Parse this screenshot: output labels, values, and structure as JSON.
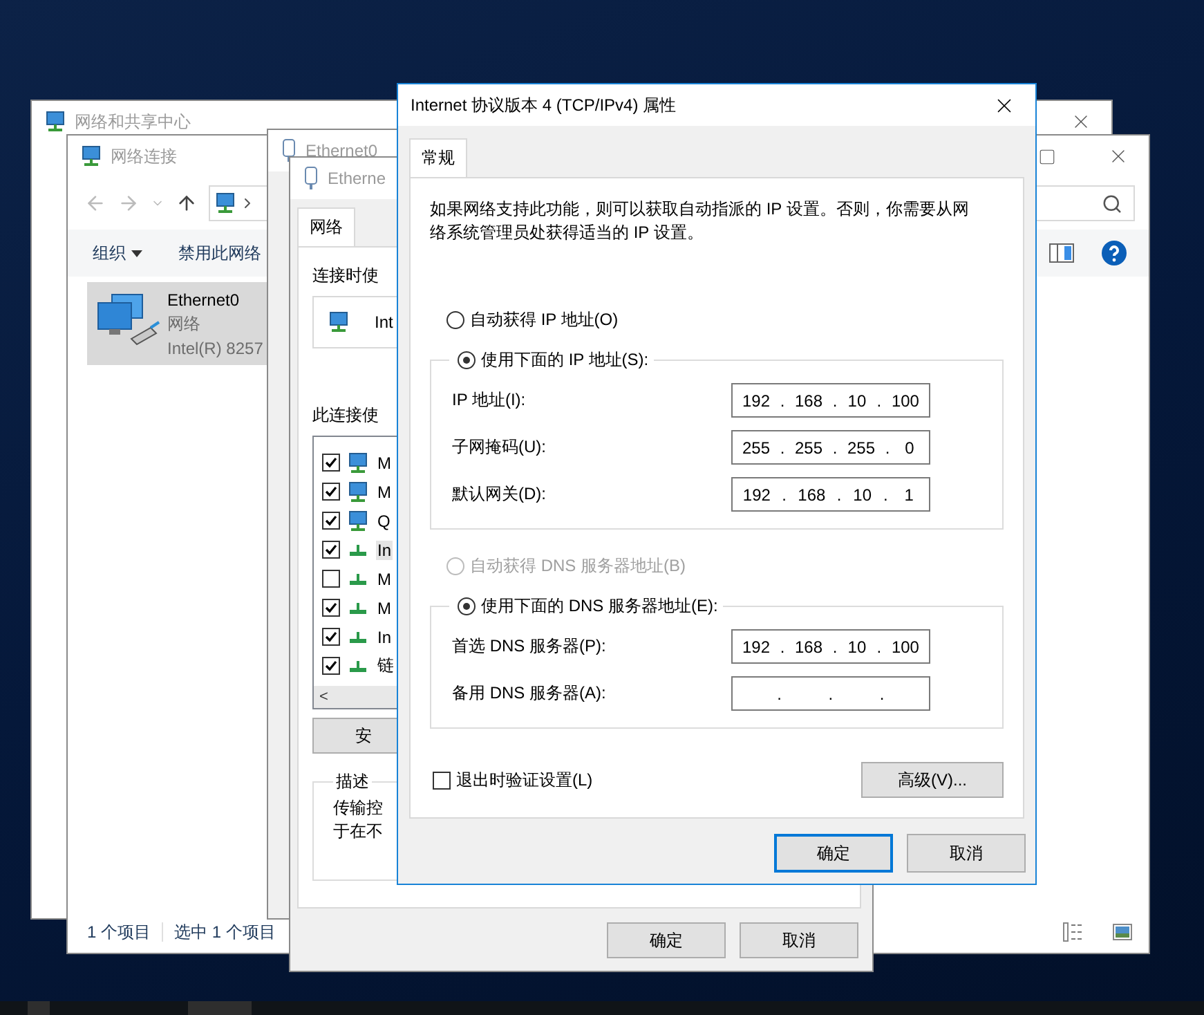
{
  "network_center": {
    "title": "网络和共享中心"
  },
  "network_connections": {
    "title": "网络连接",
    "toolbar": [
      {
        "label": "组织",
        "kind": "menu"
      },
      {
        "label": "禁用此网络",
        "kind": "button"
      }
    ],
    "items": [
      {
        "name": "Ethernet0",
        "status": "网络",
        "device": "Intel(R) 8257",
        "selected": true
      }
    ],
    "status_bar": [
      "1 个项目",
      "选中 1 个项目"
    ]
  },
  "ethernet_status": {
    "title": "Ethernet0"
  },
  "ethernet_properties": {
    "title": "Etherne",
    "tabs": [
      {
        "label": "网络",
        "selected": true
      }
    ],
    "connect_using_label": "连接时使",
    "adapter": "Int",
    "components_label": "此连接使",
    "components": [
      {
        "label": "M",
        "kind": "client",
        "checked": true,
        "selected": false
      },
      {
        "label": "M",
        "kind": "client",
        "checked": true,
        "selected": false
      },
      {
        "label": "Q",
        "kind": "client",
        "checked": true,
        "selected": false
      },
      {
        "label": "In",
        "kind": "protocol",
        "checked": true,
        "selected": true
      },
      {
        "label": "M",
        "kind": "protocol",
        "checked": false,
        "selected": false
      },
      {
        "label": "M",
        "kind": "protocol",
        "checked": true,
        "selected": false
      },
      {
        "label": "In",
        "kind": "protocol",
        "checked": true,
        "selected": false
      },
      {
        "label": "链",
        "kind": "protocol",
        "checked": true,
        "selected": false
      }
    ],
    "scroll_left": "<",
    "install_button": "安",
    "description_title": "描述",
    "description_lines": [
      "传输控",
      "于在不"
    ],
    "buttons": [
      "确定",
      "取消"
    ]
  },
  "ipv4_dialog": {
    "title": "Internet 协议版本 4 (TCP/IPv4) 属性",
    "tabs": [
      {
        "label": "常规",
        "selected": true
      }
    ],
    "intro": "如果网络支持此功能，则可以获取自动指派的 IP 设置。否则，你需要从网络系统管理员处获得适当的 IP 设置。",
    "ip_auto": {
      "label": "自动获得 IP 地址(O)",
      "selected": false,
      "disabled": false
    },
    "ip_manual": {
      "label": "使用下面的 IP 地址(S):",
      "selected": true,
      "fields": [
        {
          "label": "IP 地址(I):",
          "octets": [
            "192",
            "168",
            "10",
            "100"
          ]
        },
        {
          "label": "子网掩码(U):",
          "octets": [
            "255",
            "255",
            "255",
            "0"
          ]
        },
        {
          "label": "默认网关(D):",
          "octets": [
            "192",
            "168",
            "10",
            "1"
          ]
        }
      ]
    },
    "dns_auto": {
      "label": "自动获得 DNS 服务器地址(B)",
      "selected": false,
      "disabled": true
    },
    "dns_manual": {
      "label": "使用下面的 DNS 服务器地址(E):",
      "selected": true,
      "fields": [
        {
          "label": "首选 DNS 服务器(P):",
          "octets": [
            "192",
            "168",
            "10",
            "100"
          ]
        },
        {
          "label": "备用 DNS 服务器(A):"
        }
      ]
    },
    "separator": ".",
    "validate": {
      "label": "退出时验证设置(L)",
      "checked": false
    },
    "advanced_button": "高级(V)...",
    "buttons": [
      {
        "label": "确定",
        "default": true
      },
      {
        "label": "取消",
        "default": false
      }
    ]
  }
}
